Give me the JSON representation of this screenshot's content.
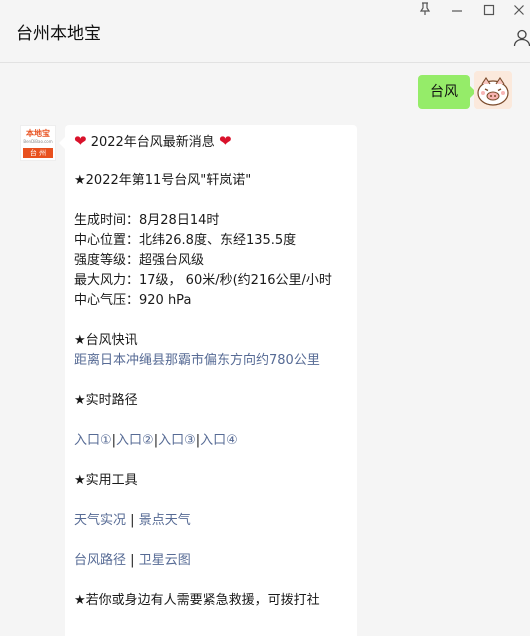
{
  "window": {
    "title": "台州本地宝",
    "pin_glyph": "⊥",
    "minimize_glyph": "—",
    "maximize_glyph": "☐",
    "close_glyph": "✕"
  },
  "sent_message": {
    "text": "台风"
  },
  "received_message": {
    "heart": "❤",
    "title": "2022年台风最新消息",
    "typhoon_name": "★2022年第11号台风\"轩岚诺\"",
    "details": [
      "生成时间：8月28日14时",
      "中心位置：北纬26.8度、东经135.5度",
      "强度等级：超强台风级",
      "最大风力：17级， 60米/秒(约216公里/小时",
      "中心气压：920 hPa"
    ],
    "news_header": "★台风快讯",
    "news_link": "距离日本冲绳县那霸市偏东方向约780公里",
    "path_header": "★实时路径",
    "path_links": [
      "入口①",
      "入口②",
      "入口③",
      "入口④"
    ],
    "divider": "|",
    "tools_header": "★实用工具",
    "tools_row1": [
      "天气实况",
      "景点天气"
    ],
    "tools_row2": [
      "台风路径",
      "卫星云图"
    ],
    "rescue_text": "★若你或身边有人需要紧急救援，可拨打社"
  },
  "avatar_logo": {
    "name": "本地宝",
    "url": "BenDiBao.com",
    "city": "台 州"
  },
  "colors": {
    "sent_bubble": "#95ec69",
    "link": "#576b95",
    "heart": "#d9122b",
    "logo_orange": "#e8501e"
  }
}
